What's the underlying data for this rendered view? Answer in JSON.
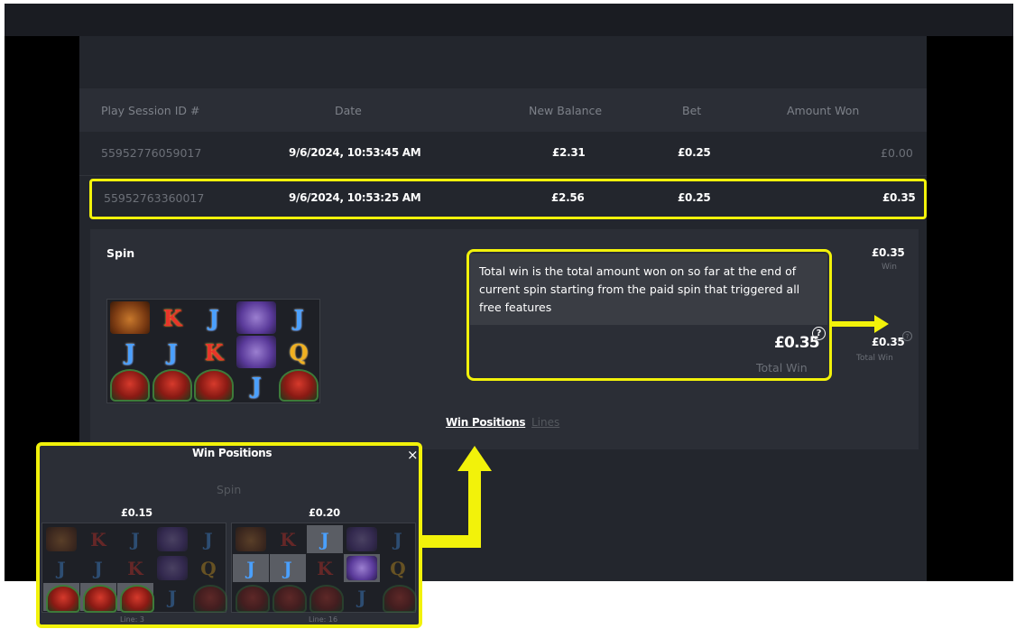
{
  "table": {
    "headers": [
      "Play Session ID #",
      "Date",
      "New Balance",
      "Bet",
      "Amount Won"
    ],
    "rows": [
      {
        "id": "55952776059017",
        "date": "9/6/2024, 10:53:45 AM",
        "balance": "£2.31",
        "bet": "£0.25",
        "won": "£0.00"
      },
      {
        "id": "55952763360017",
        "date": "9/6/2024, 10:53:25 AM",
        "balance": "£2.56",
        "bet": "£0.25",
        "won": "£0.35"
      }
    ]
  },
  "detail": {
    "title": "Spin",
    "win_amount": "£0.35",
    "win_label": "Win",
    "total_win_amount": "£0.35",
    "total_win_label": "Total Win",
    "help_icon": "?",
    "tooltip": {
      "text": "Total win is the total amount won on so far at the end of current spin starting from the paid spin that triggered all free features",
      "amount": "£0.35",
      "label": "Total Win"
    },
    "tabs": {
      "win_positions": "Win Positions",
      "lines": "Lines"
    },
    "reels": [
      [
        "bison",
        "K",
        "J",
        "wolf",
        "J"
      ],
      [
        "J",
        "J",
        "K",
        "wolf",
        "Q"
      ],
      [
        "horse",
        "horse",
        "horse",
        "J",
        "horse"
      ]
    ]
  },
  "win_positions": {
    "title": "Win Positions",
    "close": "×",
    "subtitle": "Spin",
    "wins": [
      {
        "amount": "£0.15",
        "line": "Line: 3"
      },
      {
        "amount": "£0.20",
        "line": "Line: 16"
      }
    ]
  },
  "colors": {
    "highlight": "#f2f20a",
    "background": "#23262d",
    "text": "#ffffff",
    "muted": "#6c7078"
  }
}
